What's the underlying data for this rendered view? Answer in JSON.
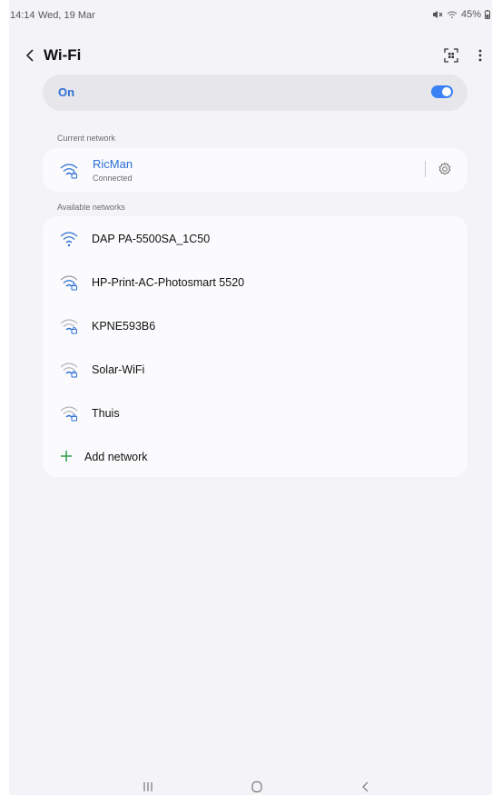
{
  "status_bar": {
    "time": "14:14",
    "date": "Wed, 19 Mar",
    "battery": "45%"
  },
  "app_bar": {
    "title": "Wi-Fi"
  },
  "toggle": {
    "label": "On",
    "enabled": true
  },
  "current_network": {
    "section_label": "Current network",
    "name": "RicMan",
    "status": "Connected"
  },
  "available_networks": {
    "section_label": "Available networks",
    "items": [
      {
        "name": "DAP PA-5500SA_1C50",
        "secured": false
      },
      {
        "name": "HP-Print-AC-Photosmart 5520",
        "secured": true
      },
      {
        "name": "KPNE593B6",
        "secured": true
      },
      {
        "name": "Solar-WiFi",
        "secured": true
      },
      {
        "name": "Thuis",
        "secured": true
      }
    ],
    "add_label": "Add network"
  },
  "colors": {
    "accent": "#2b6fd4",
    "switch": "#3b82f6",
    "add_icon": "#2e9e4a",
    "background": "#f4f4f8"
  }
}
